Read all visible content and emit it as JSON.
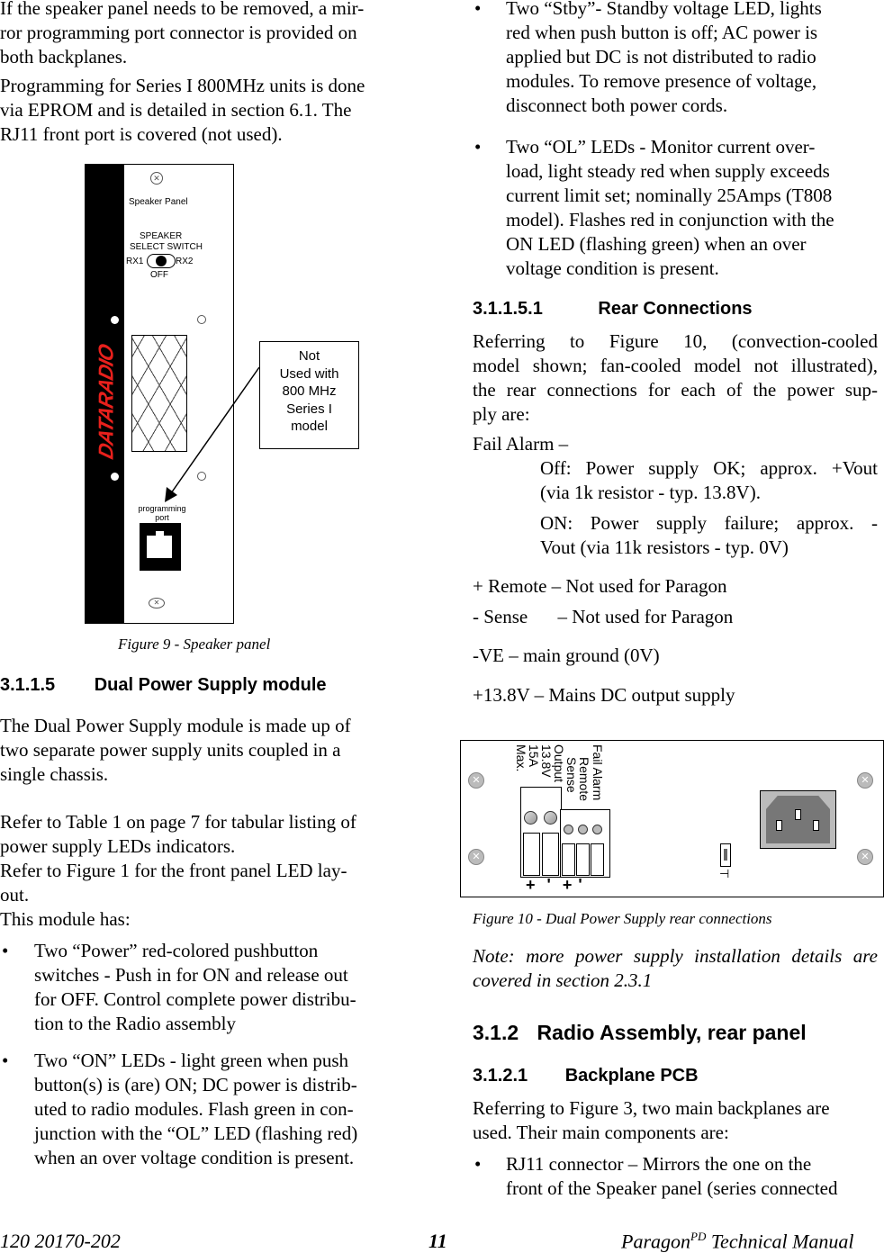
{
  "left_column": {
    "intro_para_1_lines": [
      "If the speaker panel needs to be removed, a mir-",
      "ror programming port connector is provided on",
      "both backplanes."
    ],
    "intro_para_2_lines": [
      "Programming for Series I 800MHz units is done",
      "via EPROM and is detailed in section 6.1. The",
      "RJ11 front port is covered (not used)."
    ],
    "figure9": {
      "brand": "DATARADIO",
      "panel_title": "Speaker Panel",
      "switch_label_1": "SPEAKER",
      "switch_label_2": "SELECT SWITCH",
      "switch_left": "RX1",
      "switch_right": "RX2",
      "switch_bottom": "OFF",
      "port_label_1": "programming",
      "port_label_2": "port",
      "callout_lines": [
        "Not",
        "Used with",
        "800 MHz",
        "Series I",
        "model"
      ],
      "caption": "Figure 9 - Speaker panel"
    },
    "section_3115": {
      "number": "3.1.1.5",
      "title": "Dual Power Supply module"
    },
    "dps_para_lines": [
      "The Dual Power Supply module is made up of",
      "two separate power supply units coupled in a",
      "single chassis."
    ],
    "refer_lines": [
      "Refer to Table 1 on page 7 for tabular listing of",
      "power supply LEDs indicators.",
      "Refer to Figure 1 for the front panel LED lay-",
      "out.",
      "This module has:"
    ],
    "bullets": [
      {
        "symbol": "•",
        "lines": [
          "Two “Power” red-colored pushbutton",
          "switches - Push in for ON and release out",
          "for OFF. Control complete power distribu-",
          "tion to the Radio assembly"
        ]
      },
      {
        "symbol": "•",
        "lines": [
          "Two “ON” LEDs - light green when push",
          "button(s) is (are) ON; DC power is distrib-",
          "uted to radio modules. Flash green in con-",
          "junction with the “OL” LED (flashing red)",
          "when an over voltage condition is present."
        ]
      }
    ]
  },
  "right_column": {
    "bullets": [
      {
        "symbol": "•",
        "lines": [
          "Two “Stby”- Standby voltage LED, lights",
          "red when push button is off; AC power is",
          "applied but DC is not distributed to radio",
          "modules. To remove presence of voltage,",
          "disconnect both power cords."
        ]
      },
      {
        "symbol": "•",
        "lines": [
          "Two “OL” LEDs - Monitor current over-",
          "load, light steady red when supply exceeds",
          "current limit set; nominally 25Amps (T808",
          "model). Flashes red in conjunction with the",
          "ON LED (flashing green) when an over",
          "voltage condition is present."
        ]
      }
    ],
    "section_31151": {
      "number": "3.1.1.5.1",
      "title": "Rear Connections"
    },
    "rear_para_lines": [
      "Referring to Figure 10, (convection-cooled",
      "model shown; fan-cooled model not illustrated),",
      "the rear connections for each of the power sup-",
      "ply are:"
    ],
    "fail_alarm": {
      "label": "Fail Alarm –",
      "off_lines": [
        "Off: Power supply OK; approx. +Vout",
        "(via 1k resistor - typ. 13.8V)."
      ],
      "on_lines": [
        "ON: Power supply failure; approx. -",
        "Vout (via 11k resistors - typ. 0V)"
      ]
    },
    "remote": "+ Remote – Not used for Paragon",
    "sense_label": "- Sense",
    "sense_desc": "– Not used for Paragon",
    "ve": "-VE – main ground (0V)",
    "v138": "+13.8V – Mains DC output supply",
    "figure10": {
      "output_lines": [
        "Output",
        "13.8V",
        "15A",
        "Max."
      ],
      "remote_lines": [
        "Remote",
        "Sense"
      ],
      "fail_alarm_label": "Fail Alarm",
      "polarity": [
        "+",
        "'",
        "+",
        "'"
      ],
      "caption": "Figure 10 - Dual Power Supply rear connections"
    },
    "note_lines": [
      "Note: more power supply installation details are",
      "covered in section 2.3.1"
    ],
    "section_312": {
      "number": "3.1.2",
      "title": "Radio Assembly, rear panel"
    },
    "section_3121": {
      "number": "3.1.2.1",
      "title": "Backplane PCB"
    },
    "backplane_lines": [
      "Referring to Figure 3, two main backplanes are",
      "used. Their main components are:"
    ],
    "rj11_bullet": {
      "symbol": "•",
      "lines": [
        "RJ11 connector – Mirrors the one on the",
        "front of the Speaker panel (series connected"
      ]
    }
  },
  "footer": {
    "doc_number": "120 20170-202",
    "page_number": "11",
    "manual_name": "Paragon",
    "manual_sup": "PD",
    "manual_suffix": " Technical Manual"
  }
}
